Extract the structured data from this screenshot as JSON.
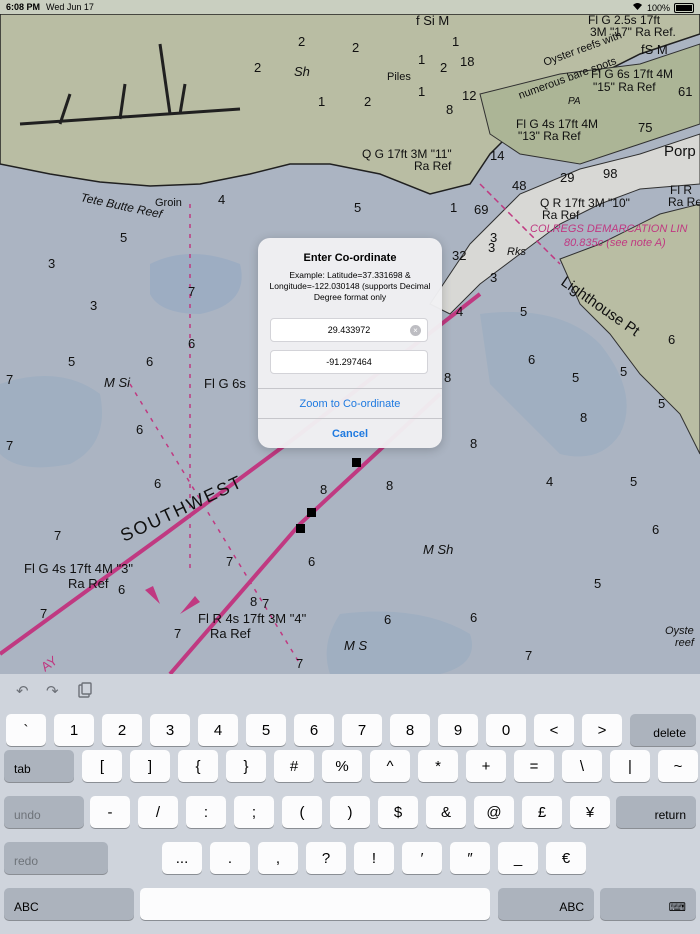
{
  "status_bar": {
    "time": "6:08 PM",
    "date": "Wed Jun 17",
    "battery": "100%"
  },
  "chart_labels": [
    "f Si M",
    "Oyster reefs with",
    "numerous bare spots",
    "fS M",
    "Fl G 2.5s 17ft",
    "3M \"17\" Ra Ref.",
    "Fl G 6s 17ft 4M",
    "\"15\" Ra Ref",
    "Fl G 4s 17ft 4M",
    "\"13\" Ra Ref",
    "Q G 17ft 3M \"11\"",
    "Ra Ref",
    "Q R 17ft 3M \"10\"",
    "Ra Ref",
    "COLREGS DEMARCATION LIN",
    "80.835c (see note A)",
    "Lighthouse Pt",
    "Tete Butte Reef",
    "Groin",
    "Piles",
    "Sh",
    "PA",
    "Porp",
    "Fl R",
    "Ra Ref",
    "Rks",
    "M Si",
    "M S",
    "M Sh",
    "Oyste",
    "reef",
    "SOUTHWEST",
    "Fl G 6s",
    "Fl G 4s 17ft 4M \"3\"",
    "Ra Ref",
    "Fl R 4s 17ft 3M \"4\"",
    "Ra Ref",
    "AY"
  ],
  "dialog": {
    "title": "Enter Co-ordinate",
    "message": "Example: Latitude=37.331698 & Longitude=-122.030148 (supports Decimal Degree format only",
    "latitude_value": "29.433972",
    "longitude_value": "-91.297464",
    "zoom_button": "Zoom to Co-ordinate",
    "cancel_button": "Cancel"
  },
  "keyboard": {
    "row1": [
      "`",
      "1",
      "2",
      "3",
      "4",
      "5",
      "6",
      "7",
      "8",
      "9",
      "0",
      "<",
      ">"
    ],
    "delete": "delete",
    "tab": "tab",
    "row2": [
      "[",
      "]",
      "{",
      "}",
      "#",
      "%",
      "^",
      "*",
      "+",
      "=",
      "\\",
      "|",
      "~"
    ],
    "undo": "undo",
    "row3": [
      "-",
      "/",
      ":",
      ";",
      "(",
      ")",
      "$",
      "&",
      "@",
      "£",
      "¥"
    ],
    "return": "return",
    "redo": "redo",
    "row4": [
      "...",
      ".",
      ",",
      "?",
      "!",
      "′",
      "″",
      "_",
      "€"
    ],
    "abc_left": "ABC",
    "abc_right": "ABC"
  }
}
